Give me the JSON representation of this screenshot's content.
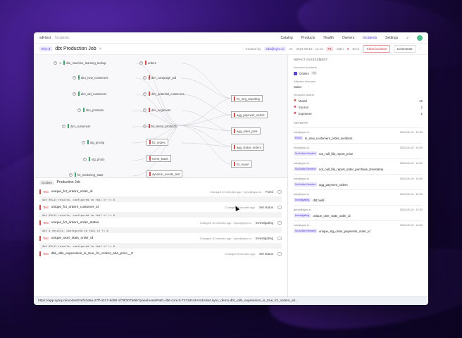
{
  "topbar": {
    "workspace": "sdl-test",
    "section": "Incidents",
    "nav": [
      "Catalog",
      "Products",
      "Health",
      "Owners",
      "Incidents",
      "Settings"
    ],
    "active_nav": "Incidents"
  },
  "titlebar": {
    "tag": "#inc-4",
    "title": "dbt Production Job",
    "created_by_label": "Created by",
    "owner": "edo@sync.io",
    "on_label": "on",
    "date": "2024-05-16 · 11:41",
    "priority": "P1",
    "priority_label": "Main",
    "error_label": "Error",
    "close_button": "Close incident",
    "comments_button": "Comments"
  },
  "lineage": {
    "nodes": [
      {
        "label": "dim_machine_learning_lookup",
        "status": "green"
      },
      {
        "label": "dim_new_customers",
        "status": "green"
      },
      {
        "label": "dim_old_customers",
        "status": "green"
      },
      {
        "label": "dim_products",
        "status": "green"
      },
      {
        "label": "dim_customers",
        "status": "green"
      },
      {
        "label": "stg_pricing",
        "status": "green"
      },
      {
        "label": "stg_photo",
        "status": "green"
      },
      {
        "label": "fct_marketing_stats",
        "status": "green"
      },
      {
        "label": "orders",
        "status": "red"
      },
      {
        "label": "dim_campaign_pid",
        "status": "red"
      },
      {
        "label": "dim_potential_customers",
        "status": "red"
      },
      {
        "label": "dim_segments",
        "status": "red"
      },
      {
        "label": "fct_menu_products",
        "status": "red"
      },
      {
        "label": "fct_orders",
        "status": "red"
      },
      {
        "label": "event_leads",
        "status": "red"
      },
      {
        "label": "dynamic_events_test",
        "status": "red"
      },
      {
        "label": "fct_mrg_reporting",
        "status": "red"
      },
      {
        "label": "agg_payment_orders",
        "status": "red"
      },
      {
        "label": "agg_order_print",
        "status": "red"
      },
      {
        "label": "agg_status_orders",
        "status": "red"
      },
      {
        "label": "fct_report",
        "status": "red"
      }
    ]
  },
  "incidents": {
    "chip": "Incident",
    "title": "Production Job",
    "rows": [
      {
        "kind": "Test",
        "name": "unique_fct_orders_order_id",
        "changed": "Changed 10 minutes ago · sync@sync.io",
        "status": "Fixed",
        "msg": "Got 99+11 results, configured to fail if != 0"
      },
      {
        "kind": "Test",
        "name": "unique_fct_orders_customer_id",
        "changed": "Changed 5 minutes ago",
        "status": "Set status",
        "msg": "Got 99+11 results, configured to fail if != 0"
      },
      {
        "kind": "Test",
        "name": "unique_fct_orders_order_status",
        "changed": "Changed 10 minutes ago · sync@sync.io",
        "status": "Investigating",
        "msg": "Got 4 results, configured to fail if != 0"
      },
      {
        "kind": "Test",
        "name": "unique_user_stats_order_id",
        "changed": "Changed 10 minutes ago · sync@sync.io",
        "status": "Investigating",
        "msg": "Got 99+11 results, configured to fail if != 0"
      },
      {
        "kind": "Test",
        "name": "dbt_utils_expression_is_true_fct_orders_abs_price__0",
        "changed": "Changed 5 minutes ago",
        "status": "Set status",
        "msg": ""
      }
    ]
  },
  "side": {
    "impact_title": "IMPACT ASSESSMENT",
    "products_label": "Impacted products",
    "product": "Orders",
    "product_tag": "P4",
    "domains_label": "Affected domains",
    "domain": "Sales",
    "assets_label": "Impacted assets",
    "assets": [
      {
        "name": "Model",
        "count": "16"
      },
      {
        "name": "Source",
        "count": "2"
      },
      {
        "name": "Exposure",
        "count": "1"
      }
    ],
    "activity_title": "ACTIVITY",
    "activity": [
      {
        "who": "edo@sync.io",
        "time": "2024-05-16 · 10:30",
        "badge": "Fixed",
        "text": "m_new_customers_order_numbers"
      },
      {
        "who": "edo@sync.io",
        "time": "2024-05-16 · 10:30",
        "badge": "No Action Needed",
        "text": "not_null_fila_report_price"
      },
      {
        "who": "edo@sync.io",
        "time": "2024-05-16 · 10:30",
        "badge": "No Action Needed",
        "text": "not_null_fila_report_order_purchase_timestamp"
      },
      {
        "who": "edo@sync.io",
        "time": "2024-05-16 · 10:30",
        "badge": "No Action Needed",
        "text": "agg_payment_orders"
      },
      {
        "who": "edo@sync.io",
        "time": "2024-05-16 · 10:30",
        "badge": "Investigating",
        "text": "dbt build"
      },
      {
        "who": "gerar@sync.io",
        "time": "2024-05-16 · 10:30",
        "badge": "Investigating",
        "text": "unique_user_stats_order_id"
      },
      {
        "who": "edo@sync.io",
        "time": "2024-05-16 · 10:30",
        "badge": "No Action Needed",
        "text": "unique_stg_order_payments_order_id"
      }
    ]
  },
  "statusbar": {
    "url": "https://app.synq.io/incident/2ef10a5a-27ff-4317-8d98-1f79f207fe8b?panelAssetPath=dbt-core:d-74734%3A%3Atest.sync_demo.dbt_utils_expression_is_true_fct_orders_ab..."
  }
}
